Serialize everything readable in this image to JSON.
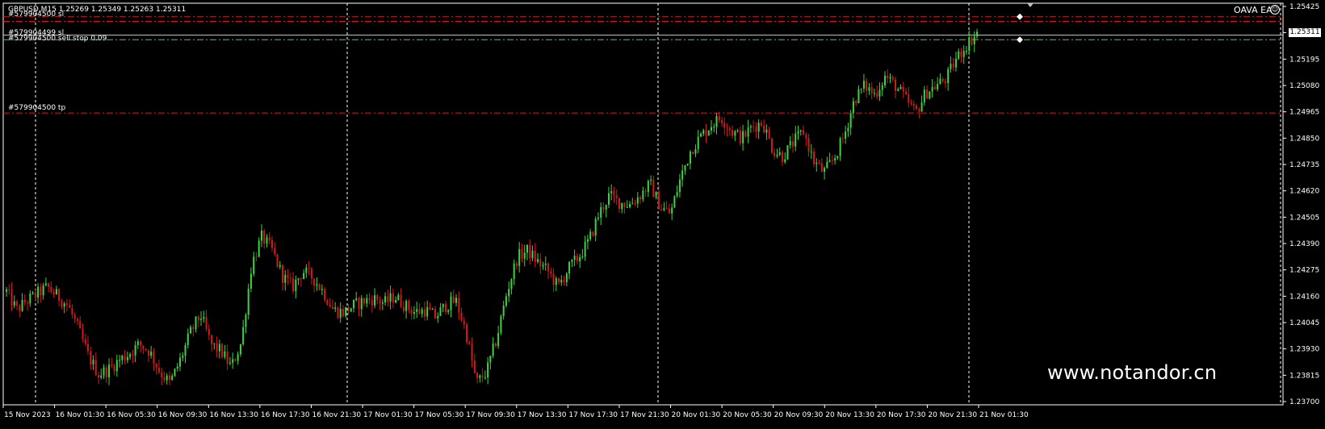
{
  "header": {
    "symbol_info": "GBPUSD,M15  1.25269 1.25349 1.25263 1.25311"
  },
  "orders": [
    {
      "label": "#579904500 sl",
      "kind": "sl"
    },
    {
      "label": "#579904499 sl",
      "kind": "sl"
    },
    {
      "label": "#579904500 sell stop 0.09",
      "kind": "entry"
    },
    {
      "label": "#579904500 tp",
      "kind": "tp"
    }
  ],
  "expert": {
    "name": "OAVA EA",
    "status_icon": "smiley-icon"
  },
  "watermark": "www.notandor.cn",
  "current_price": "1.25311",
  "colors": {
    "background": "#000000",
    "bull": "#3fd33f",
    "bear": "#d11a1a",
    "sl_line": "#d11a1a",
    "entry_line": "#3fd33f",
    "tp_line": "#d11a1a",
    "grid": "#ffffff"
  },
  "chart_data": {
    "type": "candlestick",
    "symbol": "GBPUSD",
    "timeframe": "M15",
    "price_axis": [
      "1.25425",
      "1.25311",
      "1.25195",
      "1.25080",
      "1.24965",
      "1.24850",
      "1.24735",
      "1.24620",
      "1.24505",
      "1.24390",
      "1.24275",
      "1.24160",
      "1.24045",
      "1.23930",
      "1.23815",
      "1.23700"
    ],
    "ylim": [
      1.237,
      1.25425
    ],
    "time_axis": [
      "15 Nov 2023",
      "16 Nov 01:30",
      "16 Nov 05:30",
      "16 Nov 09:30",
      "16 Nov 13:30",
      "16 Nov 17:30",
      "16 Nov 21:30",
      "17 Nov 01:30",
      "17 Nov 05:30",
      "17 Nov 09:30",
      "17 Nov 13:30",
      "17 Nov 17:30",
      "17 Nov 21:30",
      "20 Nov 01:30",
      "20 Nov 05:30",
      "20 Nov 09:30",
      "20 Nov 13:30",
      "20 Nov 17:30",
      "20 Nov 21:30",
      "21 Nov 01:30"
    ],
    "levels": [
      {
        "name": "sl-1",
        "price": 1.2538
      },
      {
        "name": "sl-2",
        "price": 1.2536
      },
      {
        "name": "entry",
        "price": 1.253
      },
      {
        "name": "sell-stop",
        "price": 1.2528
      },
      {
        "name": "tp",
        "price": 1.2496
      }
    ],
    "close_path": [
      1.2418,
      1.241,
      1.2414,
      1.2417,
      1.242,
      1.2416,
      1.2412,
      1.2402,
      1.239,
      1.2382,
      1.2384,
      1.2388,
      1.2391,
      1.2395,
      1.2392,
      1.2383,
      1.2378,
      1.2388,
      1.24,
      1.2408,
      1.2395,
      1.2392,
      1.2385,
      1.2396,
      1.243,
      1.2442,
      1.2436,
      1.2425,
      1.242,
      1.2427,
      1.2424,
      1.2418,
      1.241,
      1.2409,
      1.2412,
      1.2414,
      1.2415,
      1.2413,
      1.2416,
      1.2412,
      1.2409,
      1.241,
      1.2407,
      1.2412,
      1.2414,
      1.24,
      1.2378,
      1.2383,
      1.2398,
      1.2418,
      1.2433,
      1.2436,
      1.2431,
      1.2427,
      1.242,
      1.2428,
      1.2433,
      1.244,
      1.2452,
      1.246,
      1.2457,
      1.2456,
      1.246,
      1.2465,
      1.2455,
      1.2452,
      1.2468,
      1.248,
      1.2486,
      1.2491,
      1.2494,
      1.2488,
      1.2485,
      1.249,
      1.2492,
      1.248,
      1.2477,
      1.2483,
      1.2488,
      1.2475,
      1.247,
      1.2476,
      1.2486,
      1.2502,
      1.2508,
      1.2504,
      1.2512,
      1.2508,
      1.2502,
      1.2496,
      1.2505,
      1.2508,
      1.2511,
      1.252,
      1.2526,
      1.2531
    ]
  }
}
